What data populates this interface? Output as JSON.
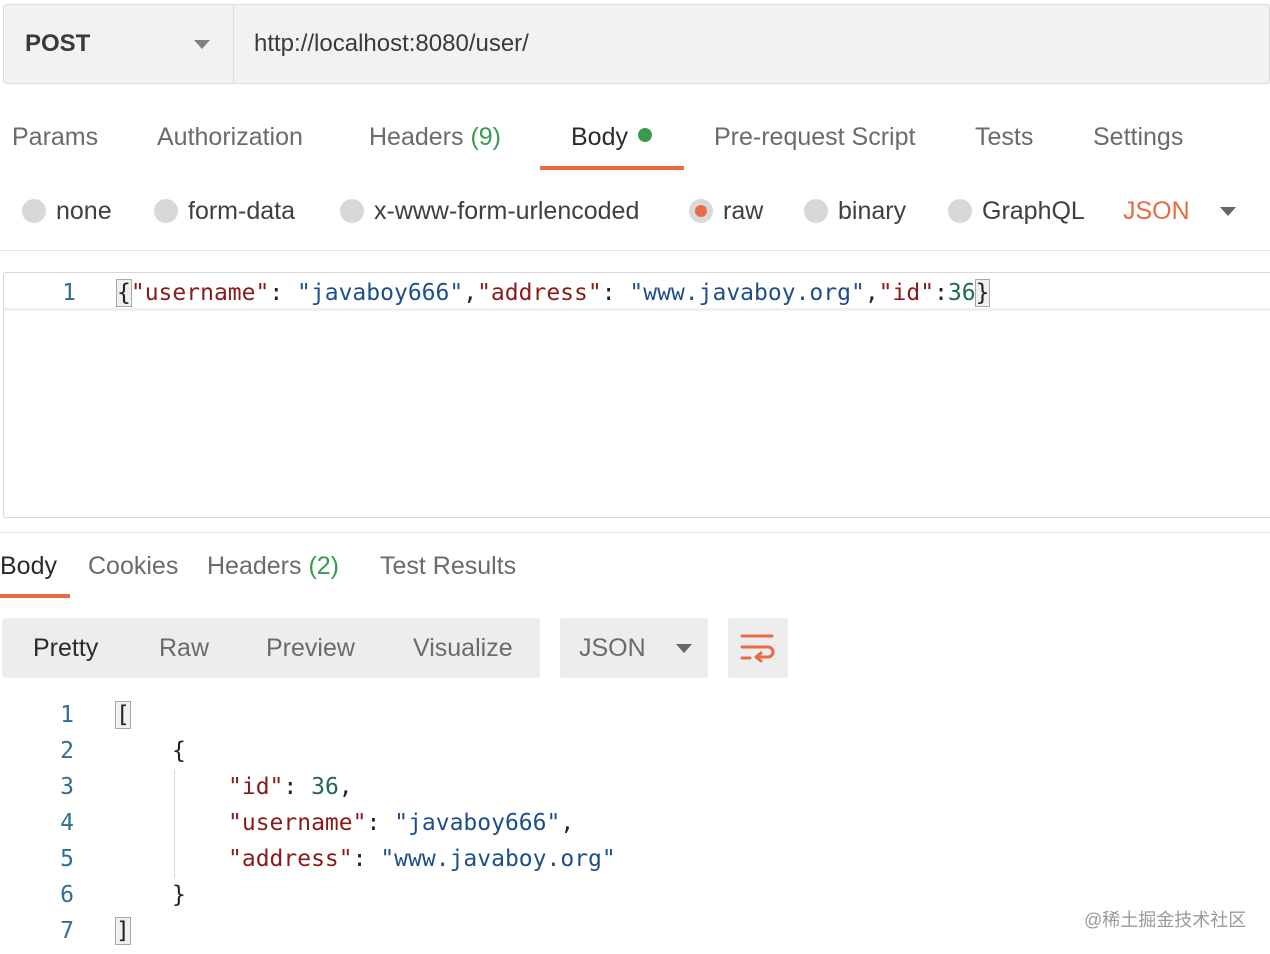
{
  "request": {
    "method": "POST",
    "url": "http://localhost:8080/user/"
  },
  "request_tabs": {
    "params": "Params",
    "authorization": "Authorization",
    "headers": "Headers",
    "headers_count": "(9)",
    "body": "Body",
    "pre_request": "Pre-request Script",
    "tests": "Tests",
    "settings": "Settings"
  },
  "body_types": {
    "none": "none",
    "form_data": "form-data",
    "urlencoded": "x-www-form-urlencoded",
    "raw": "raw",
    "binary": "binary",
    "graphql": "GraphQL",
    "selected": "raw",
    "format": "JSON"
  },
  "request_body": {
    "line_number": "1",
    "p1": "{",
    "k_username": "\"username\"",
    "c1": ": ",
    "v_username": "\"javaboy666\"",
    "c2": ",",
    "k_address": "\"address\"",
    "c3": ": ",
    "v_address": "\"www.javaboy.org\"",
    "c4": ",",
    "k_id": "\"id\"",
    "c5": ":",
    "v_id": "36",
    "p2": "}"
  },
  "response_tabs": {
    "body": "Body",
    "cookies": "Cookies",
    "headers": "Headers",
    "headers_count": "(2)",
    "test_results": "Test Results"
  },
  "response_view": {
    "pretty": "Pretty",
    "raw": "Raw",
    "preview": "Preview",
    "visualize": "Visualize",
    "format": "JSON"
  },
  "response_body": {
    "line_numbers": [
      "1",
      "2",
      "3",
      "4",
      "5",
      "6",
      "7"
    ],
    "open_array": "[",
    "open_obj": "{",
    "k_id": "\"id\"",
    "c1": ": ",
    "v_id": "36",
    "comma1": ",",
    "k_username": "\"username\"",
    "c2": ": ",
    "v_username": "\"javaboy666\"",
    "comma2": ",",
    "k_address": "\"address\"",
    "c3": ": ",
    "v_address": "\"www.javaboy.org\"",
    "close_obj": "}",
    "close_array": "]"
  },
  "watermark": "@稀土掘金技术社区",
  "colors": {
    "accent": "#e96b45",
    "success": "#3a9b4c",
    "json_key": "#8b1a1a",
    "json_string": "#1e4f8c",
    "json_number": "#1e6b4f"
  }
}
